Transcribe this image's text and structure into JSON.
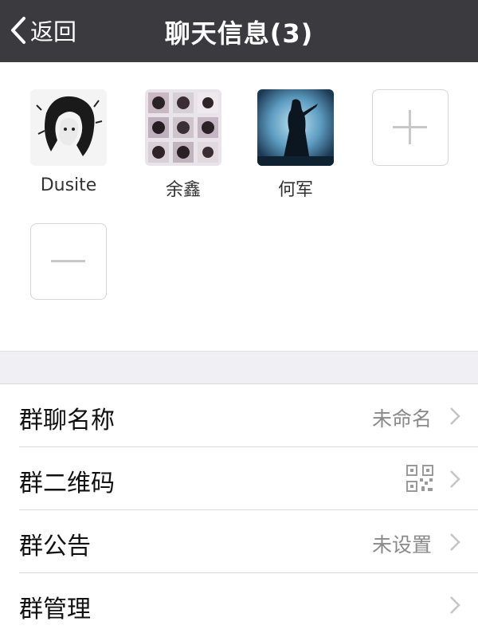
{
  "nav": {
    "back_label": "返回",
    "title": "聊天信息(3)"
  },
  "members": [
    {
      "name": "Dusite"
    },
    {
      "name": "余鑫"
    },
    {
      "name": "何军"
    }
  ],
  "menu": {
    "group_name": {
      "label": "群聊名称",
      "value": "未命名"
    },
    "group_qr": {
      "label": "群二维码"
    },
    "announcement": {
      "label": "群公告",
      "value": "未设置"
    },
    "manage": {
      "label": "群管理"
    }
  }
}
